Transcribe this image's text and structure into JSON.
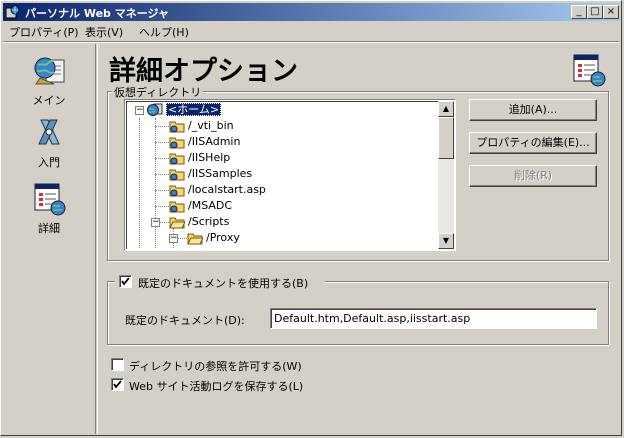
{
  "window": {
    "title": "パーソナル Web マネージャ",
    "controls": {
      "minimize": "_",
      "maximize": "□",
      "close": "×"
    }
  },
  "menu": [
    {
      "label": "プロパティ(P)"
    },
    {
      "label": "表示(V)"
    },
    {
      "label": "ヘルプ(H)"
    }
  ],
  "sidebar": {
    "items": [
      {
        "label": "メイン",
        "icon": "main-globe-icon"
      },
      {
        "label": "入門",
        "icon": "tour-icon"
      },
      {
        "label": "詳細",
        "icon": "advanced-icon"
      }
    ]
  },
  "page": {
    "title": "詳細オプション",
    "icon": "advanced-options-icon"
  },
  "virtual_dirs": {
    "group_label": "仮想ディレクトリ",
    "tree": [
      {
        "label": "<ホーム>",
        "selected": true
      },
      {
        "label": "/_vti_bin"
      },
      {
        "label": "/IISAdmin"
      },
      {
        "label": "/IISHelp"
      },
      {
        "label": "/IISSamples"
      },
      {
        "label": "/localstart.asp"
      },
      {
        "label": "/MSADC"
      },
      {
        "label": "/Scripts"
      },
      {
        "label": "/Proxy"
      }
    ],
    "buttons": {
      "add": "追加(A)...",
      "edit": "プロパティの編集(E)...",
      "remove": "削除(R)"
    }
  },
  "default_doc": {
    "enable_label": "既定のドキュメントを使用する(B)",
    "enabled": true,
    "field_label": "既定のドキュメント(D):",
    "value": "Default.htm,Default.asp,iisstart.asp"
  },
  "options": [
    {
      "label": "ディレクトリの参照を許可する(W)",
      "checked": false
    },
    {
      "label": "Web サイト活動ログを保存する(L)",
      "checked": true
    }
  ],
  "colors": {
    "titlebar_start": "#0a246a",
    "titlebar_end": "#a6caf0",
    "face": "#d4d0c8",
    "selection": "#0a246a"
  }
}
